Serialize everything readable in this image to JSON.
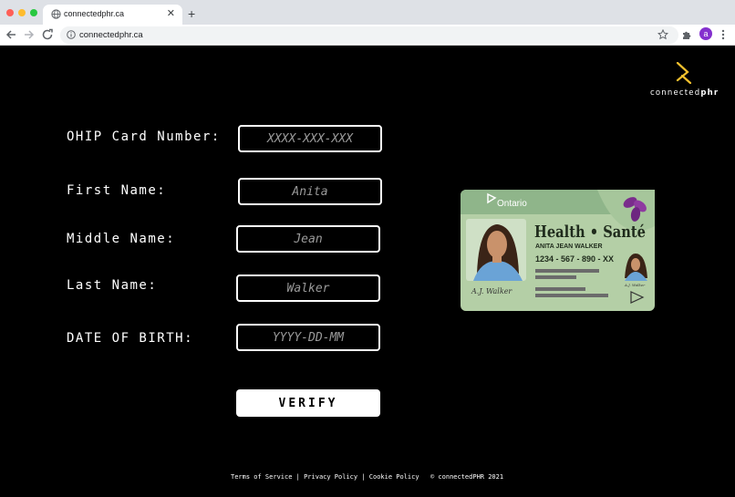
{
  "browser": {
    "tab_title": "connectedphr.ca",
    "tab_close": "✕",
    "new_tab": "+",
    "url": "connectedphr.ca",
    "profile_initial": "a"
  },
  "logo": {
    "name_regular": "connected",
    "name_bold": "phr",
    "accent_color": "#f2c12e"
  },
  "form": {
    "ohip": {
      "label": "OHIP Card Number:",
      "placeholder": "XXXX-XXX-XXX"
    },
    "first_name": {
      "label": "First Name:",
      "placeholder": "Anita"
    },
    "middle_name": {
      "label": "Middle Name:",
      "placeholder": "Jean"
    },
    "last_name": {
      "label": "Last Name:",
      "placeholder": "Walker"
    },
    "dob": {
      "label": "DATE OF BIRTH:",
      "placeholder": "YYYY-DD-MM"
    },
    "verify_label": "VERIFY"
  },
  "card": {
    "province": "Ontario",
    "title": "Health • Santé",
    "holder_name": "ANITA JEAN WALKER",
    "number": "1234 - 567 - 890 - XX",
    "signature": "A.J. Walker",
    "small_signature": "A.J. Walker",
    "bg_color": "#b4cfa6",
    "header_color": "#8fb58a"
  },
  "footer": {
    "terms": "Terms of Service",
    "sep1": "|",
    "privacy": "Privacy Policy",
    "sep2": "|",
    "cookie": "Cookie Policy",
    "copyright": "© connectedPHR 2021"
  }
}
